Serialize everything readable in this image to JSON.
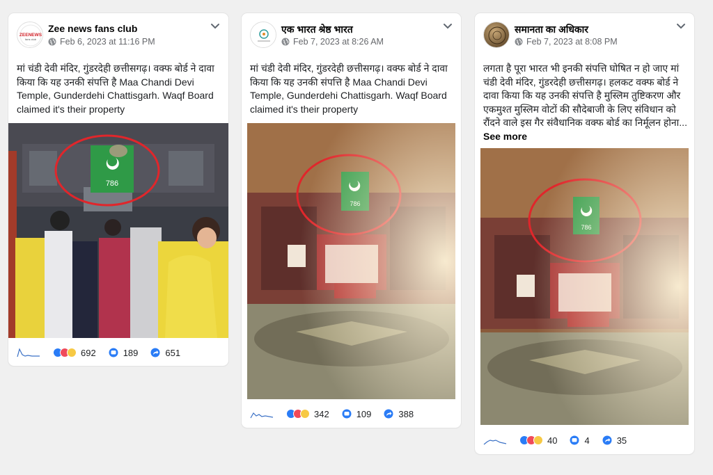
{
  "posts": [
    {
      "page_name": "Zee news fans club",
      "avatar_text": "ZEENEWS",
      "avatar_subtext": "fans club",
      "timestamp": "Feb 6, 2023 at 11:16 PM",
      "text": "मां चंडी देवी मंदिर, गुंडरदेही छत्तीसगढ़। वक्फ बोर्ड ने दावा किया कि यह उनकी संपत्ति है Maa Chandi Devi Temple, Gunderdehi Chattisgarh. Waqf Board claimed it's their property",
      "see_more": "",
      "photo_flag_text": "786",
      "reactions": "692",
      "comments": "189",
      "shares": "651"
    },
    {
      "page_name": "एक भारत श्रेष्ठ भारत",
      "avatar_text": "",
      "avatar_subtext": "",
      "timestamp": "Feb 7, 2023 at 8:26 AM",
      "text": "मां चंडी देवी मंदिर, गुंडरदेही छत्तीसगढ़। वक्फ बोर्ड ने दावा किया कि यह उनकी संपत्ति है Maa Chandi Devi Temple, Gunderdehi Chattisgarh. Waqf Board claimed it's their property",
      "see_more": "",
      "photo_flag_text": "786",
      "reactions": "342",
      "comments": "109",
      "shares": "388"
    },
    {
      "page_name": "समानता का अधिकार",
      "avatar_text": "",
      "avatar_subtext": "",
      "timestamp": "Feb 7, 2023 at 8:08 PM",
      "text": "लगता है पूरा भारत भी इनकी संपत्ति घोषित न हो जाए मां चंडी देवी मंदिर, गुंडरदेही छत्तीसगढ़। हलकट वक्फ बोर्ड ने दावा किया कि यह उनकी संपत्ति है मुस्लिम तुष्टिकरण और एकमुश्त मुस्लिम वोटों की सौदेबाजी के लिए संविधान को रौंदने वाले इस गैर संवैधानिक वक्फ बोर्ड का निर्मूलन होना...",
      "see_more": "See more",
      "photo_flag_text": "786",
      "reactions": "40",
      "comments": "4",
      "shares": "35"
    }
  ],
  "colors": {
    "highlight_circle": "#e0262b",
    "flag_green": "#2e8b3a",
    "link_blue": "#2a7cf6"
  }
}
